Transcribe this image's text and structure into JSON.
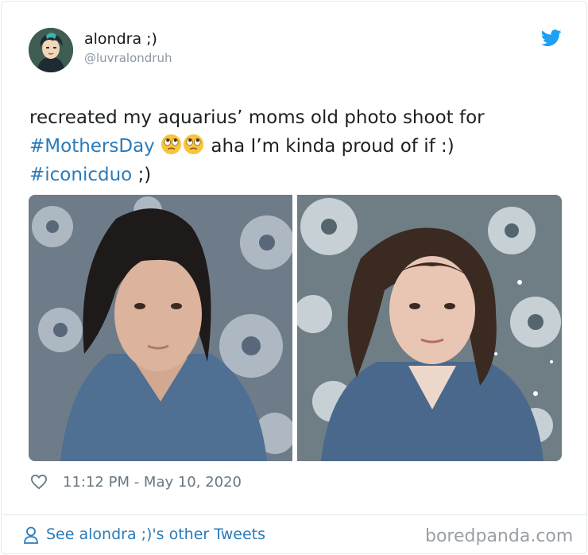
{
  "tweet": {
    "author_name": "alondra ;)",
    "author_handle": "@luvralondruh",
    "text_line1": "recreated my aquarius’ moms old photo shoot for",
    "hashtag1": "#MothersDay",
    "text_line2_rest": "aha I’m kinda proud of if :)",
    "hashtag2": "#iconicduo",
    "text_line3_rest": ";)",
    "timestamp": "11:12 PM - May 10, 2020",
    "see_more": "See alondra ;)'s other Tweets"
  },
  "watermark": "boredpanda.com",
  "icons": [
    "twitter-bird-icon",
    "eyes-rolling-emoji-icon",
    "heart-icon",
    "person-icon"
  ],
  "colors": {
    "link": "#2b7bb9",
    "twitter_blue": "#1da1f2",
    "meta": "#697882"
  }
}
